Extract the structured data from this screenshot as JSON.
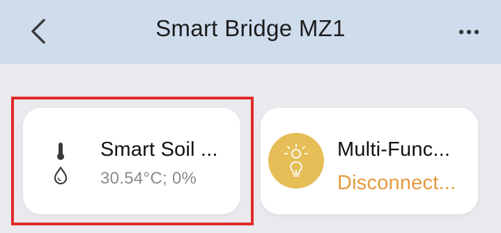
{
  "header": {
    "title": "Smart Bridge MZ1",
    "background_color": "#cfdcec"
  },
  "icons": {
    "back": "chevron-left-icon",
    "more": "ellipsis-icon",
    "soil": "thermometer-droplet-icon",
    "multi": "bulb-icon"
  },
  "devices": [
    {
      "name": "Smart Soil ...",
      "value": "30.54°C; 0%",
      "selected": true
    },
    {
      "name": "Multi-Func...",
      "status": "Disconnect...",
      "status_color": "#e5993e",
      "icon_bg_color": "#e6be58"
    }
  ],
  "colors": {
    "selection_border": "#e12a2a",
    "page_background": "#e9e9ee"
  }
}
